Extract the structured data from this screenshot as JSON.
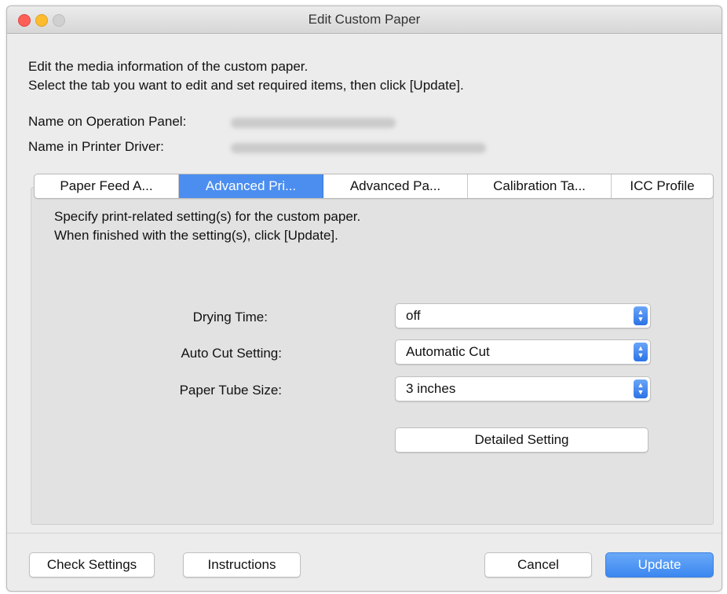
{
  "window": {
    "title": "Edit Custom Paper"
  },
  "intro": {
    "line1": "Edit the media information of the custom paper.",
    "line2": "Select the tab you want to edit and set required items, then click [Update]."
  },
  "names": {
    "operation_panel_label": "Name on Operation Panel:",
    "printer_driver_label": "Name in Printer Driver:"
  },
  "tabs": [
    {
      "label": "Paper Feed A...",
      "active": false
    },
    {
      "label": "Advanced Pri...",
      "active": true
    },
    {
      "label": "Advanced Pa...",
      "active": false
    },
    {
      "label": "Calibration Ta...",
      "active": false
    },
    {
      "label": "ICC Profile",
      "active": false
    }
  ],
  "panel": {
    "desc1": "Specify print-related setting(s) for the custom paper.",
    "desc2": "When finished with the setting(s), click [Update].",
    "drying_time": {
      "label": "Drying Time:",
      "value": "off"
    },
    "auto_cut": {
      "label": "Auto Cut Setting:",
      "value": "Automatic Cut"
    },
    "paper_tube": {
      "label": "Paper Tube Size:",
      "value": "3 inches"
    },
    "detailed_setting_label": "Detailed Setting"
  },
  "footer": {
    "check_settings_label": "Check Settings",
    "instructions_label": "Instructions",
    "cancel_label": "Cancel",
    "update_label": "Update"
  },
  "colors": {
    "accent": "#4b8ef0",
    "close": "#fc5f57",
    "minimize": "#fdbc2e",
    "zoom_inactive": "#d0d0d0"
  }
}
